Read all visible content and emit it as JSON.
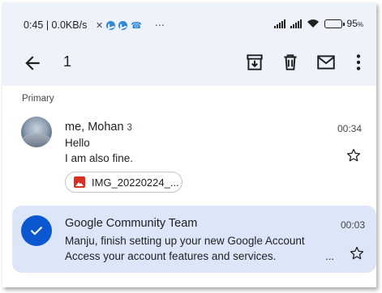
{
  "statusbar": {
    "time": "0:45",
    "speed": "0.0KB/s",
    "battery_label": "95",
    "battery_level": 0.95
  },
  "toolbar": {
    "selected_count": "1",
    "icons": [
      "back-arrow-icon",
      "archive-icon",
      "delete-icon",
      "mark-unread-icon",
      "more-vert-icon"
    ]
  },
  "section": {
    "label": "Primary"
  },
  "emails": [
    {
      "sender": "me, Mohan",
      "count": "3",
      "time": "00:34",
      "subject": "Hello",
      "snippet": "I am also fine.",
      "attachment": "IMG_20220224_...",
      "selected": false
    },
    {
      "sender": "Google Community Team",
      "time": "00:03",
      "subject": "Manju, finish setting up your new Google Account",
      "snippet": "Access your account features and services.",
      "ellipsis": "...",
      "selected": true
    }
  ],
  "colors": {
    "header_bg": "#eef2fb",
    "selected_row_bg": "#dde6f8",
    "accent_blue": "#0b57d0",
    "attachment_red": "#d93025"
  }
}
